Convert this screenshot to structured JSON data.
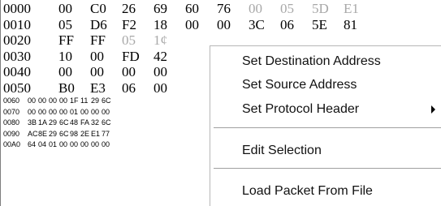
{
  "hex_rows_large": [
    {
      "offset": "0000",
      "bytes": [
        "00",
        "C0",
        "26",
        "69",
        "60",
        "76"
      ],
      "gray_bytes": [
        "00",
        "05",
        "5D",
        "E1"
      ]
    },
    {
      "offset": "0010",
      "bytes": [
        "05",
        "D6",
        "F2",
        "18",
        "00",
        "00",
        "3C",
        "06",
        "5E",
        "81"
      ],
      "gray_bytes": []
    },
    {
      "offset": "0020",
      "bytes": [
        "FF",
        "FF"
      ],
      "gray_bytes": [
        "05",
        "1¢"
      ]
    },
    {
      "offset": "0030",
      "bytes": [
        "10",
        "00",
        "FD",
        "42"
      ],
      "gray_bytes": []
    },
    {
      "offset": "0040",
      "bytes": [
        "00",
        "00",
        "00",
        "00"
      ],
      "gray_bytes": []
    },
    {
      "offset": "0050",
      "bytes": [
        "B0",
        "E3",
        "06",
        "00"
      ],
      "gray_bytes": []
    }
  ],
  "hex_rows_small": [
    {
      "offset": "0060",
      "bytes": [
        "00",
        "00",
        "00",
        "00",
        "1F",
        "11",
        "29",
        "6C"
      ]
    },
    {
      "offset": "0070",
      "bytes": [
        "00",
        "00",
        "00",
        "00",
        "01",
        "00",
        "00",
        "00"
      ]
    },
    {
      "offset": "0080",
      "bytes": [
        "3B",
        "1A",
        "29",
        "6C",
        "48",
        "FA",
        "32",
        "6C"
      ]
    },
    {
      "offset": "0090",
      "bytes": [
        "AC",
        "8E",
        "29",
        "6C",
        "98",
        "2E",
        "E1",
        "77"
      ]
    },
    {
      "offset": "00A0",
      "bytes": [
        "64",
        "04",
        "01",
        "00",
        "00",
        "00",
        "00",
        "00"
      ]
    }
  ],
  "context_menu": {
    "items": [
      {
        "label": "Set Destination Address"
      },
      {
        "label": "Set Source Address"
      },
      {
        "label": "Set Protocol Header",
        "submenu": true
      },
      {
        "label": "Edit Selection"
      },
      {
        "label": "Load Packet From File"
      }
    ]
  }
}
